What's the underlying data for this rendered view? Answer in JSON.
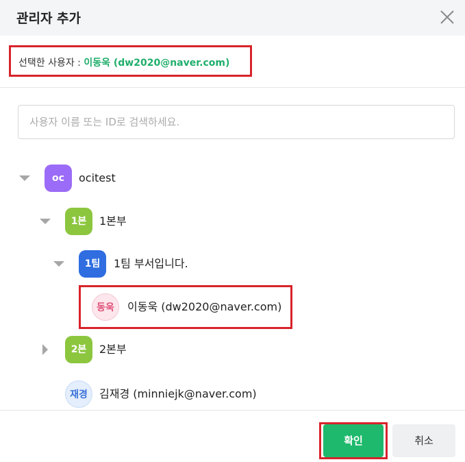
{
  "dialog": {
    "title": "관리자 추가"
  },
  "selected": {
    "label": "선택한 사용자 :",
    "value": "이동욱 (dw2020@naver.com)"
  },
  "search": {
    "placeholder": "사용자 이름 또는 ID로 검색하세요."
  },
  "tree": {
    "org": {
      "badge": "oc",
      "label": "ocitest",
      "color": "#9b6cf7"
    },
    "division1": {
      "badge": "1본",
      "label": "1본부",
      "color": "#8cc63f"
    },
    "team1": {
      "badge": "1팀",
      "label": "1팀 부서입니다.",
      "color": "#2f6de0"
    },
    "user_selected": {
      "badge": "동욱",
      "label": "이동욱 (dw2020@naver.com)",
      "badge_bg": "#fde7ec",
      "badge_color": "#e0517a"
    },
    "division2": {
      "badge": "2본",
      "label": "2본부",
      "color": "#8cc63f"
    },
    "user2": {
      "badge": "재경",
      "label": "김재경 (minniejk@naver.com)",
      "badge_bg": "#e4eefc",
      "badge_color": "#3b72d9"
    }
  },
  "footer": {
    "confirm_label": "확인",
    "cancel_label": "취소"
  },
  "colors": {
    "highlight": "#d8232a",
    "accent_green": "#1eb96c"
  }
}
